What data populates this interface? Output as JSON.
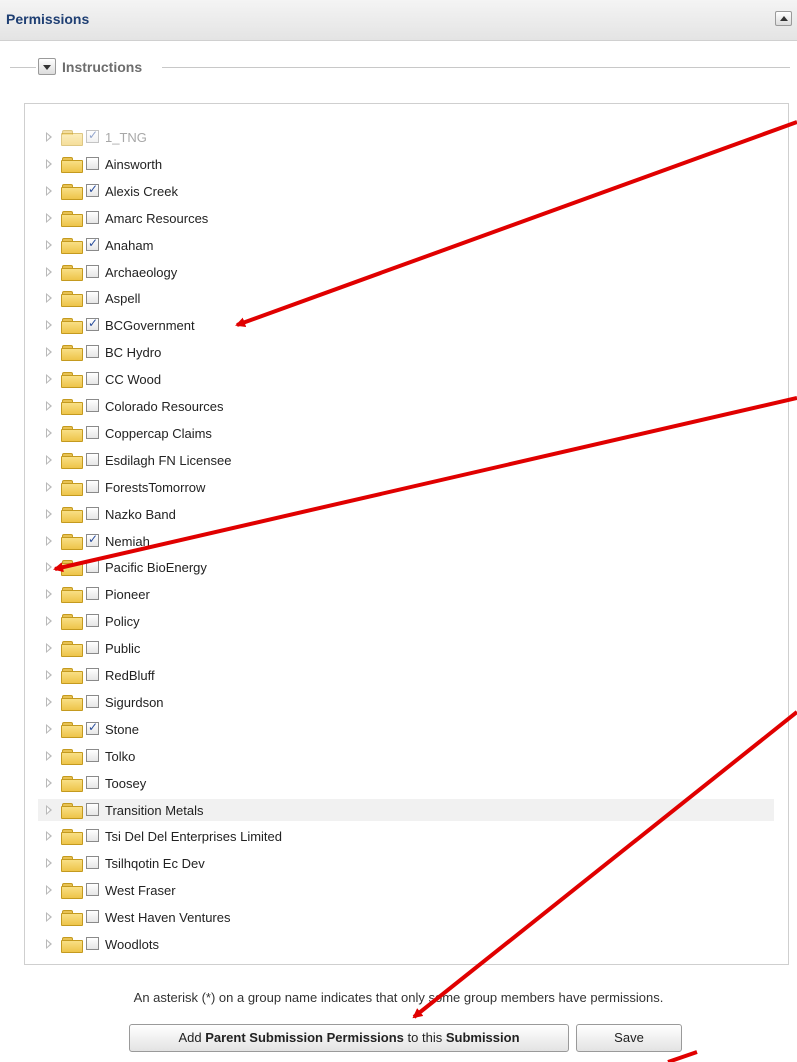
{
  "panel": {
    "title": "Permissions",
    "instructions_label": "Instructions"
  },
  "tree": {
    "items": [
      {
        "label": "1_TNG",
        "checked": true,
        "disabled": true
      },
      {
        "label": "Ainsworth",
        "checked": false
      },
      {
        "label": "Alexis Creek",
        "checked": true
      },
      {
        "label": "Amarc Resources",
        "checked": false
      },
      {
        "label": "Anaham",
        "checked": true
      },
      {
        "label": "Archaeology",
        "checked": false
      },
      {
        "label": "Aspell",
        "checked": false
      },
      {
        "label": "BCGovernment",
        "checked": true
      },
      {
        "label": "BC Hydro",
        "checked": false
      },
      {
        "label": "CC Wood",
        "checked": false
      },
      {
        "label": "Colorado Resources",
        "checked": false
      },
      {
        "label": "Coppercap Claims",
        "checked": false
      },
      {
        "label": "Esdilagh FN Licensee",
        "checked": false
      },
      {
        "label": "ForestsTomorrow",
        "checked": false
      },
      {
        "label": "Nazko Band",
        "checked": false
      },
      {
        "label": "Nemiah",
        "checked": true
      },
      {
        "label": "Pacific BioEnergy",
        "checked": false
      },
      {
        "label": "Pioneer",
        "checked": false
      },
      {
        "label": "Policy",
        "checked": false
      },
      {
        "label": "Public",
        "checked": false
      },
      {
        "label": "RedBluff",
        "checked": false
      },
      {
        "label": "Sigurdson",
        "checked": false
      },
      {
        "label": "Stone",
        "checked": true
      },
      {
        "label": "Tolko",
        "checked": false
      },
      {
        "label": "Toosey",
        "checked": false
      },
      {
        "label": "Transition Metals",
        "checked": false,
        "highlighted": true
      },
      {
        "label": "Tsi Del Del Enterprises Limited",
        "checked": false
      },
      {
        "label": "Tsilhqotin Ec Dev",
        "checked": false
      },
      {
        "label": "West Fraser",
        "checked": false
      },
      {
        "label": "West Haven Ventures",
        "checked": false
      },
      {
        "label": "Woodlots",
        "checked": false
      }
    ]
  },
  "footer": {
    "note": "An asterisk (*) on a group name indicates that only some group members have permissions.",
    "add_button": {
      "prefix": "Add ",
      "bold1": "Parent Submission Permissions",
      "middle": " to this ",
      "bold2": "Submission"
    },
    "save_label": "Save"
  },
  "colors": {
    "annotation_arrow": "#e00000",
    "title": "#1f3f73",
    "check": "#2a4e9c"
  }
}
